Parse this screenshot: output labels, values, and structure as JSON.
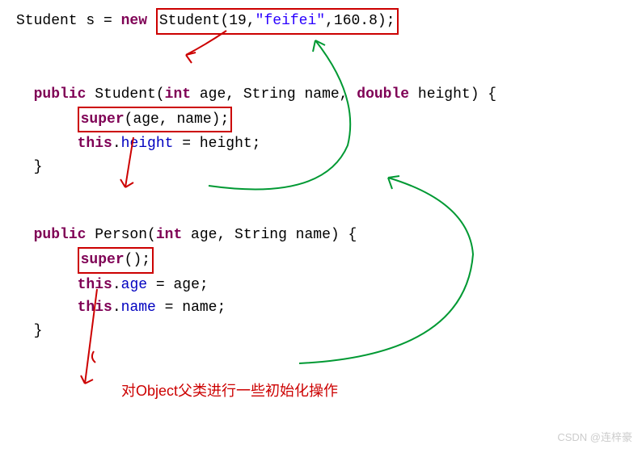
{
  "line1": {
    "part1": "Student s = ",
    "keyword_new": "new",
    "space": " ",
    "boxed": {
      "pre": "Student(19,",
      "str": "\"feifei\"",
      "post": ",160.8);"
    }
  },
  "student_ctor": {
    "decl": {
      "kw_public": "public",
      "name": " Student(",
      "kw_int": "int",
      "p1": " age, String name, ",
      "kw_double": "double",
      "p2": " height) {"
    },
    "super_line": {
      "kw_super": "super",
      "args": "(age, name);"
    },
    "this_line": {
      "kw_this": "this",
      "dot": ".",
      "field": "height",
      "eq": " = height;"
    },
    "close": "}"
  },
  "person_ctor": {
    "decl": {
      "kw_public": "public",
      "name": " Person(",
      "kw_int": "int",
      "p1": " age, String name) {"
    },
    "super_line": {
      "kw_super": "super",
      "args": "();"
    },
    "age_line": {
      "kw_this": "this",
      "dot": ".",
      "field": "age",
      "eq": " = age;"
    },
    "name_line": {
      "kw_this": "this",
      "dot": ".",
      "field": "name",
      "eq": " = name;"
    },
    "close": "}"
  },
  "annotation_text": "对Object父类进行一些初始化操作",
  "watermark": "CSDN @连梓豪"
}
